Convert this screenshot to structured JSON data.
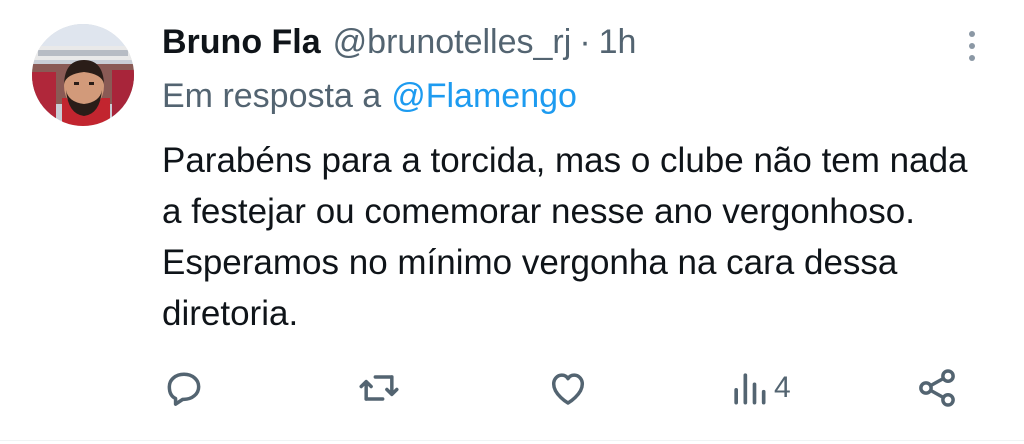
{
  "tweet": {
    "display_name": "Bruno Fla",
    "handle": "@brunotelles_rj",
    "separator": "·",
    "time": "1h",
    "reply_prefix": "Em resposta a",
    "reply_mention": "@Flamengo",
    "text": "Parabéns para a torcida, mas o clube não tem nada a festejar ou comemorar nesse ano vergonhoso. Esperamos no mínimo vergonha na cara dessa diretoria."
  },
  "actions": {
    "views_count": "4"
  },
  "colors": {
    "text_primary": "#0f1419",
    "text_secondary": "#536471",
    "link": "#1d9bf0",
    "icon": "#536471"
  },
  "icons": {
    "more": "more-vertical-icon",
    "reply": "reply-icon",
    "retweet": "retweet-icon",
    "like": "like-icon",
    "views": "views-icon",
    "share": "share-icon"
  }
}
